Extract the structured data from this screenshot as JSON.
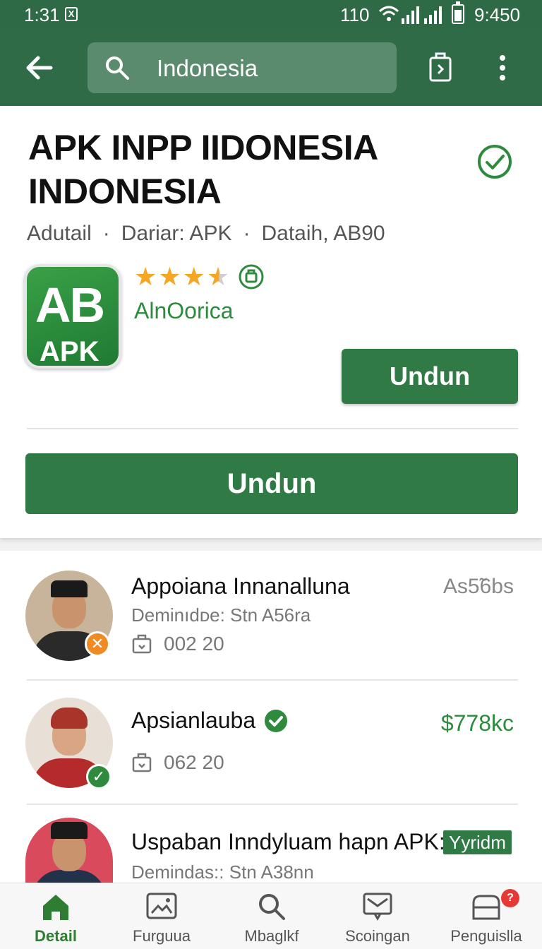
{
  "status_bar": {
    "time": "1:31",
    "notification_glyph": "X",
    "level": "110",
    "clock": "9:450"
  },
  "app_bar": {
    "search_text": "Indonesia",
    "icons": [
      "back-arrow-icon",
      "search-icon",
      "share-icon",
      "more-vert-icon"
    ]
  },
  "app": {
    "title": "APK INPP IIDONESIA INDONESIA",
    "meta": [
      "Adutail",
      "Dariar: APK",
      "Dataih, AB90"
    ],
    "icon_text_top": "AB",
    "icon_text_bottom": "APK",
    "rating": 3.5,
    "developer": "AlnOorica",
    "install_small_label": "Undun",
    "install_big_label": "Undun"
  },
  "list": [
    {
      "name": "Appoiana Innanalluna",
      "sub": "Deminıdᴅe: Stn A56ra",
      "stat": "002 20",
      "right": "As5̃6bs",
      "badge": "x"
    },
    {
      "name": "Apsianlauba",
      "stat": "062 20",
      "right": "$778kc",
      "badge": "check"
    },
    {
      "name": "Uspaban Inndyluam hapn APK:",
      "sub": "Demindas:: Stn A38nn",
      "tag": "Yyridm"
    }
  ],
  "bottom_nav": [
    {
      "label": "Detail",
      "icon": "home-icon",
      "active": true
    },
    {
      "label": "Furguua",
      "icon": "gallery-icon",
      "active": false
    },
    {
      "label": "Mbaglkf",
      "icon": "search-icon",
      "active": false
    },
    {
      "label": "Scoingan",
      "icon": "inbox-icon",
      "active": false
    },
    {
      "label": "Penguislla",
      "icon": "store-icon",
      "active": false,
      "badge": "?"
    }
  ],
  "colors": {
    "primary": "#2e6b46",
    "button": "#2f7a45",
    "accent_green": "#2e8b3e",
    "star": "#f5a623",
    "error": "#e53935",
    "orange_badge": "#f08a24"
  }
}
